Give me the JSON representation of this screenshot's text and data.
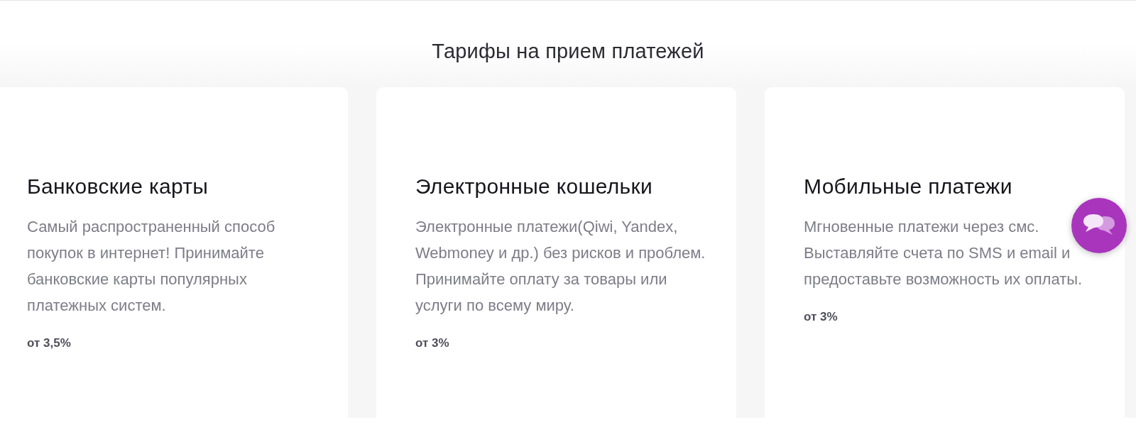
{
  "heading": "Тарифы на прием платежей",
  "cards": [
    {
      "title": "Банковские карты",
      "description": "Самый распространенный способ покупок в интернет! Принимайте банковские карты популярных платежных систем.",
      "price": "от 3,5%"
    },
    {
      "title": "Электронные кошельки",
      "description": "Электронные платежи(Qiwi, Yandex, Webmoney и др.) без рисков и проблем. Принимайте оплату за товары или услуги по всему миру.",
      "price": "от 3%"
    },
    {
      "title": "Мобильные платежи",
      "description": "Мгновенные платежи через смс.\nВыставляйте счета по SMS и email и предоставьте возможность их оплаты.",
      "price": "от 3%"
    }
  ]
}
